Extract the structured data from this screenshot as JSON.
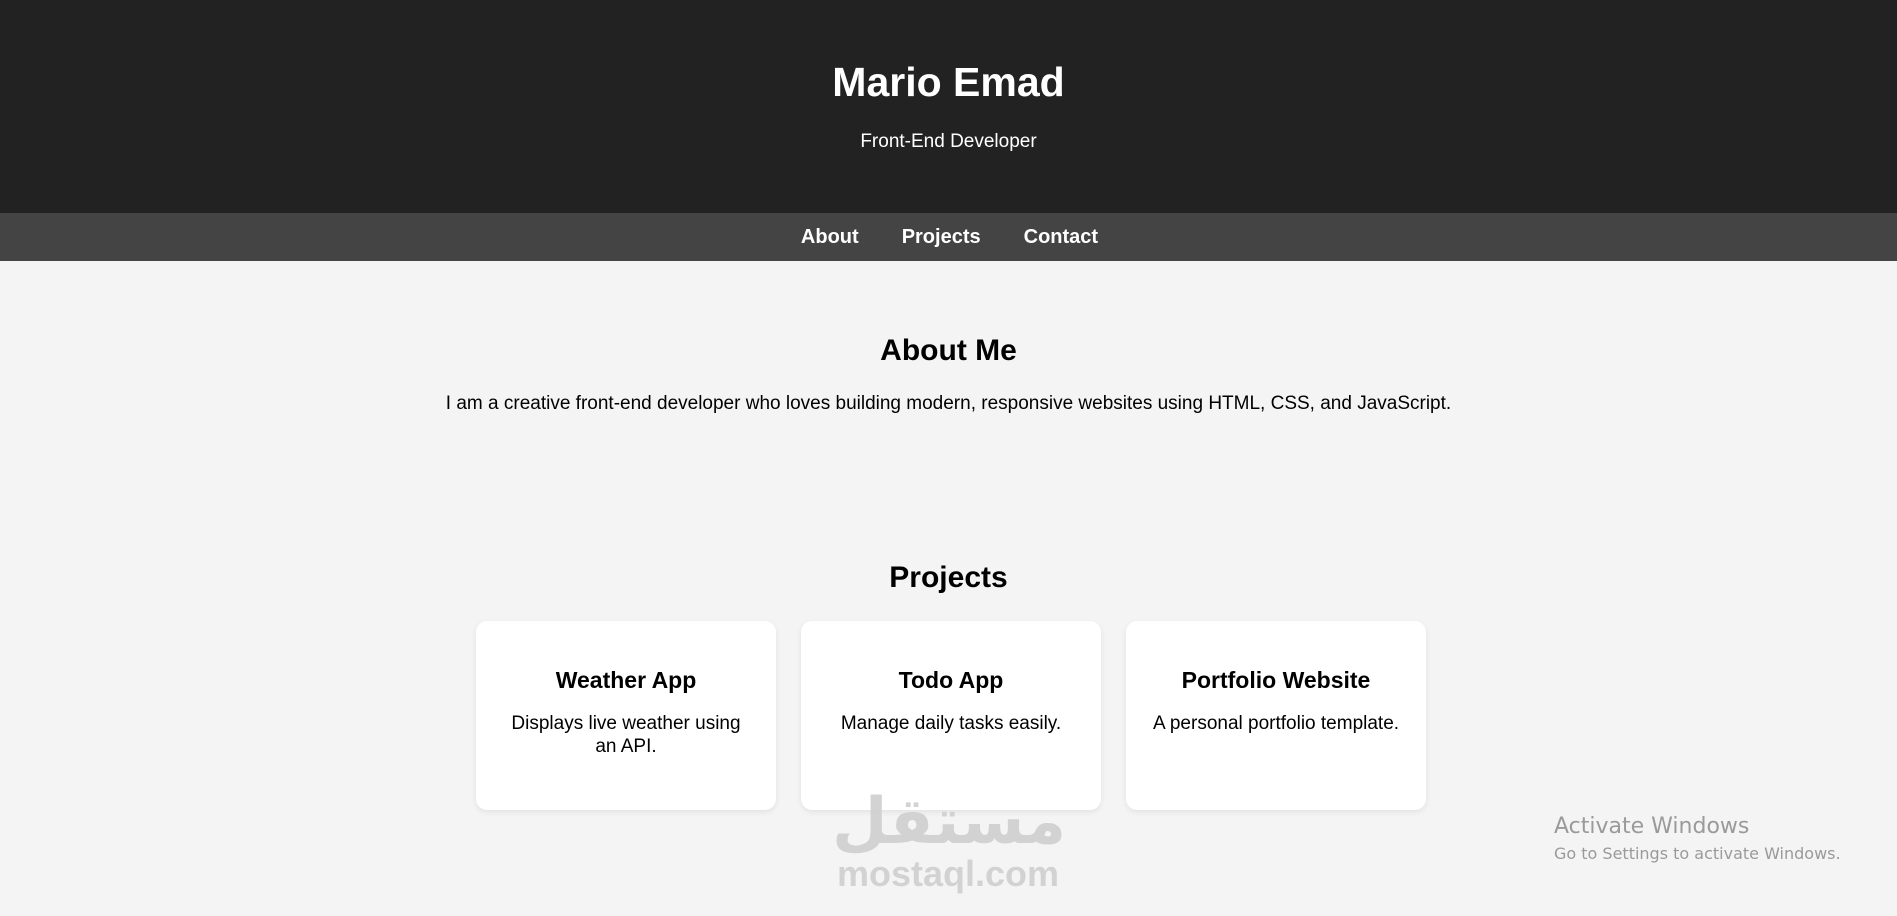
{
  "header": {
    "title": "Mario Emad",
    "subtitle": "Front-End Developer"
  },
  "nav": {
    "items": [
      {
        "label": "About"
      },
      {
        "label": "Projects"
      },
      {
        "label": "Contact"
      }
    ]
  },
  "about": {
    "title": "About Me",
    "text": "I am a creative front-end developer who loves building modern, responsive websites using HTML, CSS, and JavaScript."
  },
  "projects": {
    "title": "Projects",
    "cards": [
      {
        "title": "Weather App",
        "description": "Displays live weather using an API."
      },
      {
        "title": "Todo App",
        "description": "Manage daily tasks easily."
      },
      {
        "title": "Portfolio Website",
        "description": "A personal portfolio template."
      }
    ]
  },
  "watermark": {
    "arabic": "مستقل",
    "latin": "mostaql.com"
  },
  "os_overlay": {
    "line1": "Activate Windows",
    "line2": "Go to Settings to activate Windows."
  },
  "colors": {
    "header_bg": "#222222",
    "nav_bg": "#444444",
    "page_bg": "#f4f4f4",
    "card_bg": "#ffffff"
  }
}
